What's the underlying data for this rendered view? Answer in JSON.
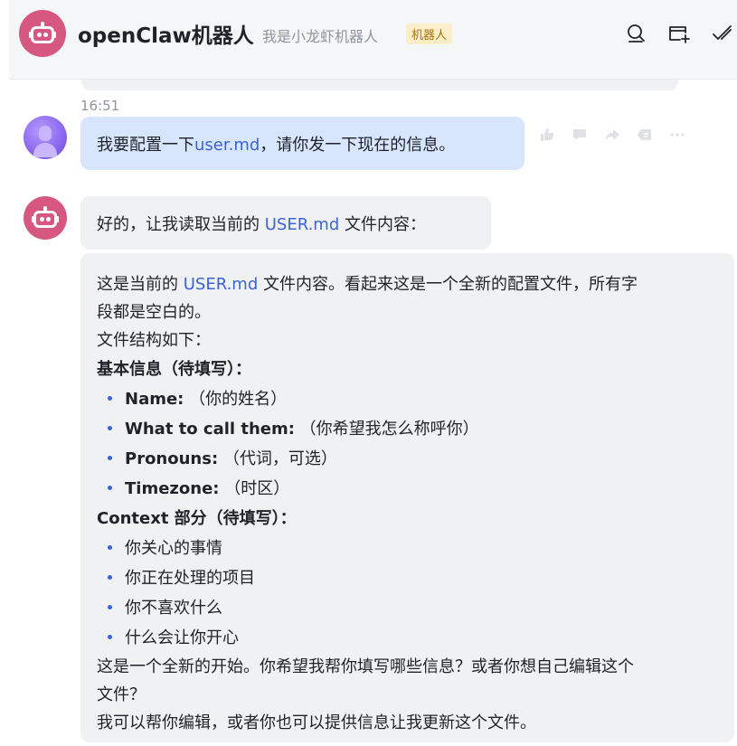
{
  "header": {
    "title": "openClaw机器人",
    "subtitle": "我是小龙虾机器人",
    "tag": "机器人"
  },
  "timestamp": "16:51",
  "user_message": {
    "prefix": "我要配置一下",
    "link": "user.md",
    "suffix": "，请你发一下现在的信息。"
  },
  "bot_reply_1": {
    "prefix": "好的，让我读取当前的 ",
    "link": "USER.md",
    "suffix": " 文件内容："
  },
  "bot_reply_2": {
    "intro_prefix": "这是当前的 ",
    "intro_link": "USER.md",
    "intro_suffix": " 文件内容。看起来这是一个全新的配置文件，所有字",
    "intro_line2": "段都是空白的。",
    "structure": "文件结构如下：",
    "section1_heading": "基本信息（待填写）：",
    "section1_items": [
      {
        "key": "Name:",
        "value": " （你的姓名）"
      },
      {
        "key": "What to call them:",
        "value": " （你希望我怎么称呼你）"
      },
      {
        "key": "Pronouns:",
        "value": " （代词，可选）"
      },
      {
        "key": "Timezone:",
        "value": " （时区）"
      }
    ],
    "section2_heading": "Context 部分（待填写）：",
    "section2_items": [
      "你关心的事情",
      "你正在处理的项目",
      "你不喜欢什么",
      "什么会让你开心"
    ],
    "closing_line1": "这是一个全新的开始。你希望我帮你填写哪些信息？或者你想自己编辑这个",
    "closing_line2": "文件？",
    "closing_line3": "我可以帮你编辑，或者你也可以提供信息让我更新这个文件。"
  },
  "icons": {
    "header": [
      "search-icon",
      "new-window-icon",
      "done-icon"
    ],
    "message_tools": [
      "thumbs-up-icon",
      "comment-icon",
      "forward-icon",
      "reply-icon",
      "more-icon"
    ]
  },
  "colors": {
    "bot_avatar": "#d6577f",
    "user_bubble": "#d8e6fd",
    "bot_bubble": "#f0f1f2",
    "link": "#3a63d9",
    "tag_bg": "#fbeec8",
    "tag_text": "#a9730f"
  }
}
